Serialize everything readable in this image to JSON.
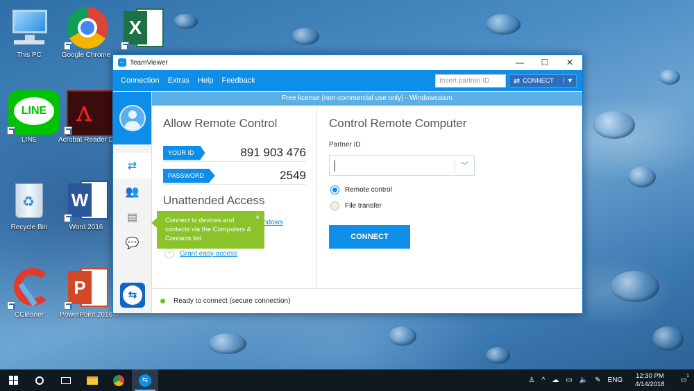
{
  "desktop": {
    "icons": [
      {
        "label": "This PC"
      },
      {
        "label": "Google Chrome"
      },
      {
        "label": ""
      },
      {
        "label": "LINE"
      },
      {
        "label": "Acrobat Reader DC"
      },
      {
        "label": "Recycle Bin"
      },
      {
        "label": "Word 2016"
      },
      {
        "label": "CCleaner"
      },
      {
        "label": "PowerPoint 2016"
      }
    ],
    "line_logo_text": "LINE",
    "word_letter": "W",
    "excel_letter": "X",
    "ppt_letter": "P"
  },
  "window": {
    "title": "TeamViewer",
    "controls": {
      "minimize": "—",
      "maximize": "☐",
      "close": "✕"
    },
    "menu": [
      "Connection",
      "Extras",
      "Help",
      "Feedback"
    ],
    "partner_placeholder": "Insert partner ID",
    "connect_top_label": "CONNECT",
    "license_banner": "Free license (non-commercial use only) - Windowssiam",
    "allow": {
      "title": "Allow Remote Control",
      "your_id_label": "YOUR ID",
      "your_id": "891 903 476",
      "password_label": "PASSWORD",
      "password": "2549",
      "unattended_title": "Unattended Access",
      "start_link_partial": "ndows",
      "grant_link": "Grant easy access"
    },
    "control": {
      "title": "Control Remote Computer",
      "partner_id_label": "Partner ID",
      "partner_id_value": "",
      "options": [
        {
          "label": "Remote control",
          "selected": true
        },
        {
          "label": "File transfer",
          "selected": false
        }
      ],
      "connect_label": "CONNECT"
    },
    "tooltip": "Connect to devices and contacts via the Computers & Contacts list.",
    "tooltip_close": "×",
    "status": "Ready to connect (secure connection)"
  },
  "taskbar": {
    "lang": "ENG",
    "time": "12:30 PM",
    "date": "4/14/2018",
    "notification_count": "1"
  },
  "colors": {
    "accent": "#0e8ee9",
    "tooltip": "#8bc32b",
    "status_ok": "#6fc21d"
  }
}
